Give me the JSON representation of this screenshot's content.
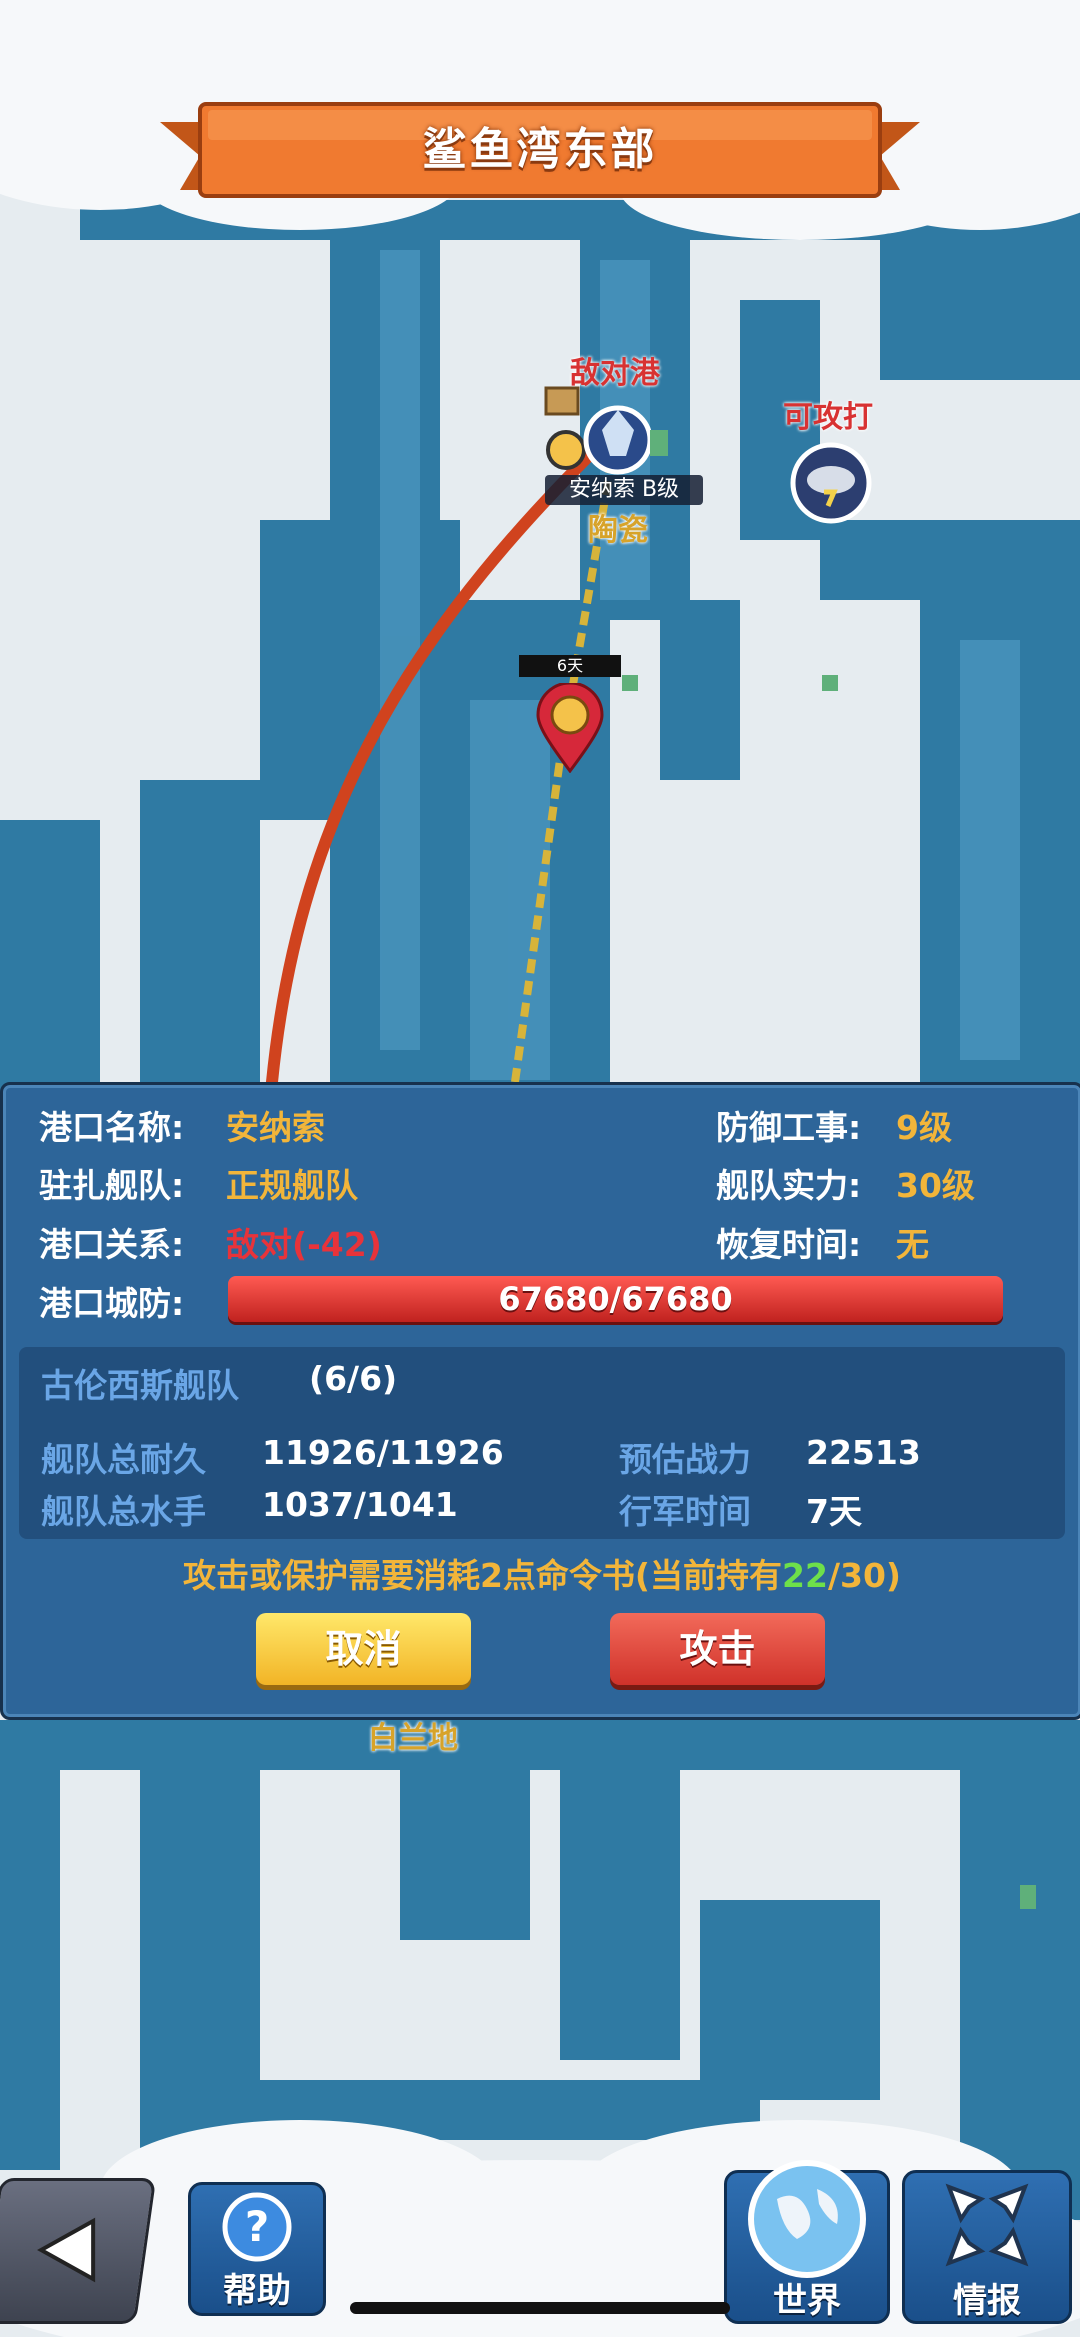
{
  "title": "鲨鱼湾东部",
  "map_labels": {
    "enemy_port": "敌对港",
    "attackable": "可攻打",
    "port_tag": "安纳索 B级",
    "port_goods": "陶瓷",
    "travel_time": "6天",
    "bottom_place": "白兰地"
  },
  "port_info": {
    "name_label": "港口名称:",
    "name_value": "安纳索",
    "defense_label": "防御工事:",
    "defense_value": "9级",
    "garrison_label": "驻扎舰队:",
    "garrison_value": "正规舰队",
    "strength_label": "舰队实力:",
    "strength_value": "30级",
    "relation_label": "港口关系:",
    "relation_value": "敌对(-42)",
    "recovery_label": "恢复时间:",
    "recovery_value": "无",
    "citydef_label": "港口城防:",
    "citydef_value": "67680/67680",
    "citydef_fraction": 1.0
  },
  "fleet": {
    "name": "古伦西斯舰队",
    "count": "(6/6)",
    "durability_label": "舰队总耐久",
    "durability_value": "11926/11926",
    "sailors_label": "舰队总水手",
    "sailors_value": "1037/1041",
    "power_label": "预估战力",
    "power_value": "22513",
    "march_label": "行军时间",
    "march_value": "7天"
  },
  "notice": {
    "prefix": "攻击或保护需要消耗2点命令书(当前持有",
    "current": "22",
    "suffix": "/30)"
  },
  "buttons": {
    "cancel": "取消",
    "attack": "攻击"
  },
  "bottom_nav": {
    "help": "帮助",
    "world": "世界",
    "intel": "情报"
  },
  "colors": {
    "sea": "#2f7aa3",
    "land": "#e6ecf0",
    "panel": "#2d6599",
    "accent_orange": "#f07a30",
    "value_gold": "#f2b53a",
    "hostile_red": "#e8333a",
    "highlight_green": "#6ee04a"
  }
}
